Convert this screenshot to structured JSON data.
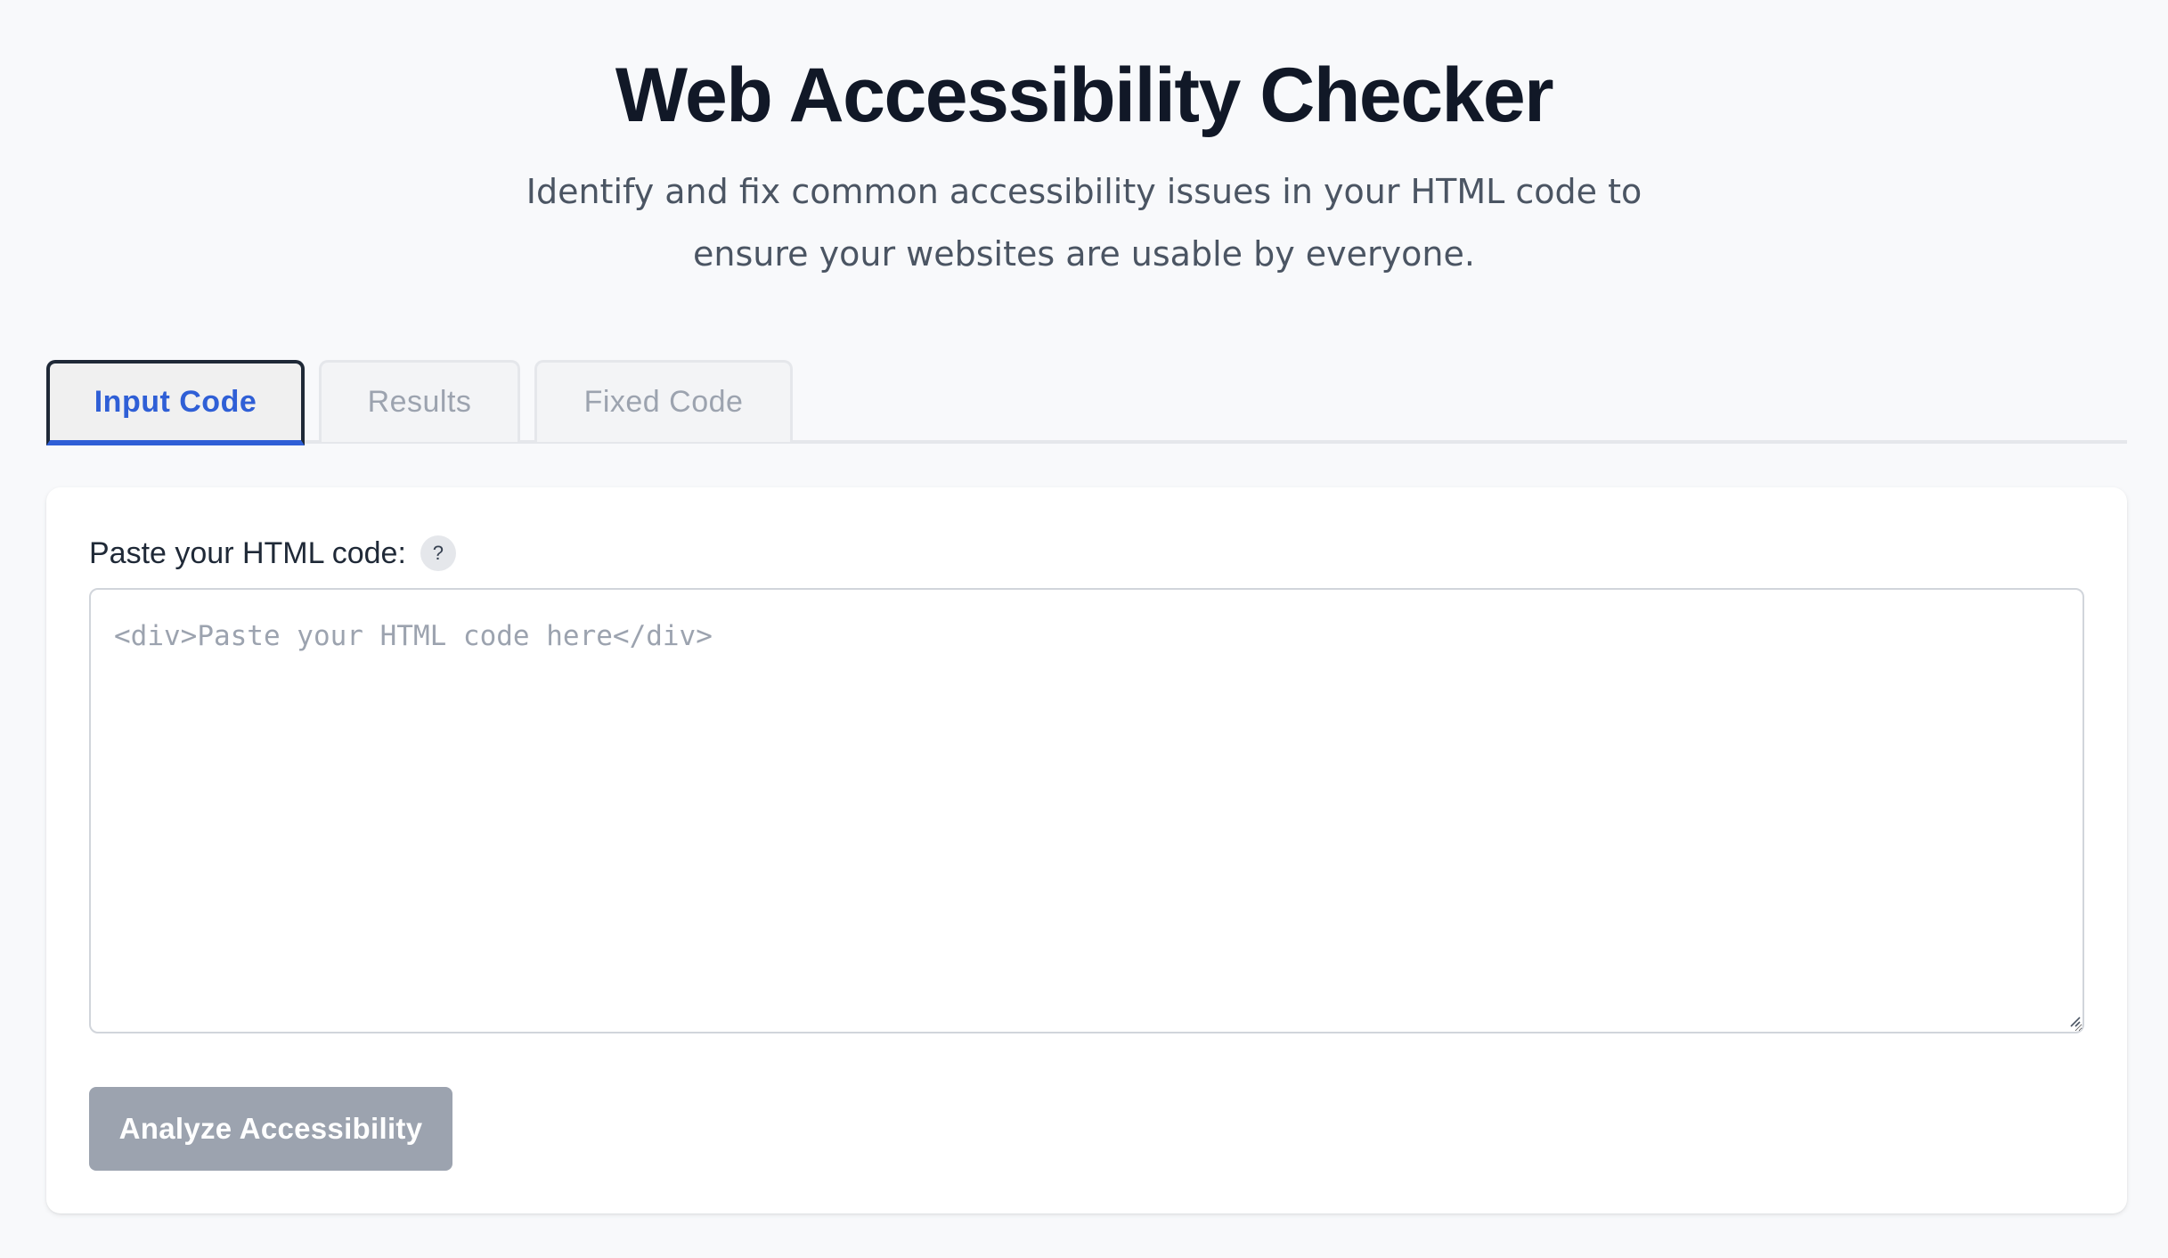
{
  "header": {
    "title": "Web Accessibility Checker",
    "subtitle": "Identify and fix common accessibility issues in your HTML code to ensure your websites are usable by everyone."
  },
  "tabs": [
    {
      "label": "Input Code",
      "active": true
    },
    {
      "label": "Results",
      "active": false
    },
    {
      "label": "Fixed Code",
      "active": false
    }
  ],
  "input_panel": {
    "label": "Paste your HTML code:",
    "help_icon_text": "?",
    "code_value": "",
    "code_placeholder": "<div>Paste your HTML code here</div>",
    "analyze_label": "Analyze Accessibility",
    "analyze_disabled": true
  },
  "colors": {
    "accent": "#2f5fd6",
    "background": "#f8f9fb",
    "disabled_button": "#9ca3af",
    "title_text": "#111827"
  },
  "icons": {
    "help": "question-mark-icon",
    "resize": "resize-grip-icon"
  }
}
